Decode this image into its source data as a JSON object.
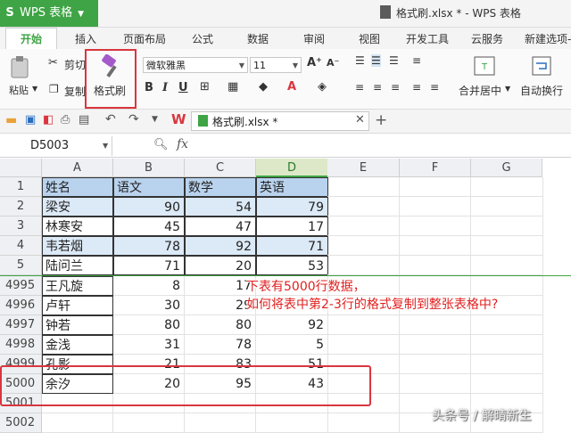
{
  "app": {
    "title": "WPS 表格",
    "window_title": "格式刷.xlsx * - WPS 表格"
  },
  "menu": [
    "开始",
    "插入",
    "页面布局",
    "公式",
    "数据",
    "审阅",
    "视图",
    "开发工具",
    "云服务",
    "新建选项-"
  ],
  "ribbon": {
    "cut": "剪切",
    "copy": "复制",
    "paste": "粘贴",
    "format_painter": "格式刷",
    "font": "微软雅黑",
    "font_size": "11",
    "merge_center": "合并居中",
    "wrap": "自动换行"
  },
  "tab": {
    "name": "格式刷.xlsx *"
  },
  "formula": {
    "cell_ref": "D5003",
    "fx": "fx"
  },
  "columns": [
    "A",
    "B",
    "C",
    "D",
    "E",
    "F",
    "G"
  ],
  "selected_column": "D",
  "rows": [
    {
      "num": "1",
      "a": "姓名",
      "b": "语文",
      "c": "数学",
      "d": "英语",
      "style": "header"
    },
    {
      "num": "2",
      "a": "梁安",
      "b": "90",
      "c": "54",
      "d": "79",
      "style": "band"
    },
    {
      "num": "3",
      "a": "林寒安",
      "b": "45",
      "c": "47",
      "d": "17",
      "style": "plain"
    },
    {
      "num": "4",
      "a": "韦若烟",
      "b": "78",
      "c": "92",
      "d": "71",
      "style": "band"
    },
    {
      "num": "5",
      "a": "陆问兰",
      "b": "71",
      "c": "20",
      "d": "53",
      "style": "plain"
    },
    {
      "num": "4995",
      "a": "王凡旋",
      "b": "8",
      "c": "17",
      "d": "",
      "style": "raw"
    },
    {
      "num": "4996",
      "a": "卢轩",
      "b": "30",
      "c": "29",
      "d": "",
      "style": "raw"
    },
    {
      "num": "4997",
      "a": "钟若",
      "b": "80",
      "c": "80",
      "d": "92",
      "style": "raw"
    },
    {
      "num": "4998",
      "a": "金浅",
      "b": "31",
      "c": "78",
      "d": "5",
      "style": "raw"
    },
    {
      "num": "4999",
      "a": "孔影",
      "b": "21",
      "c": "83",
      "d": "51",
      "style": "raw"
    },
    {
      "num": "5000",
      "a": "余汐",
      "b": "20",
      "c": "95",
      "d": "43",
      "style": "raw"
    },
    {
      "num": "5001",
      "a": "",
      "b": "",
      "c": "",
      "d": "",
      "style": "empty"
    },
    {
      "num": "5002",
      "a": "",
      "b": "",
      "c": "",
      "d": "",
      "style": "empty"
    }
  ],
  "annotation": {
    "line1": "下表有5000行数据，",
    "line2": "如何将表中第2-3行的格式复制到整张表格中?"
  },
  "watermark": "头条号 / 解晴新生",
  "colors": {
    "accent": "#3ea445",
    "band": "#dce9f7",
    "header": "#b9d3ee",
    "highlight": "#d9363e"
  }
}
